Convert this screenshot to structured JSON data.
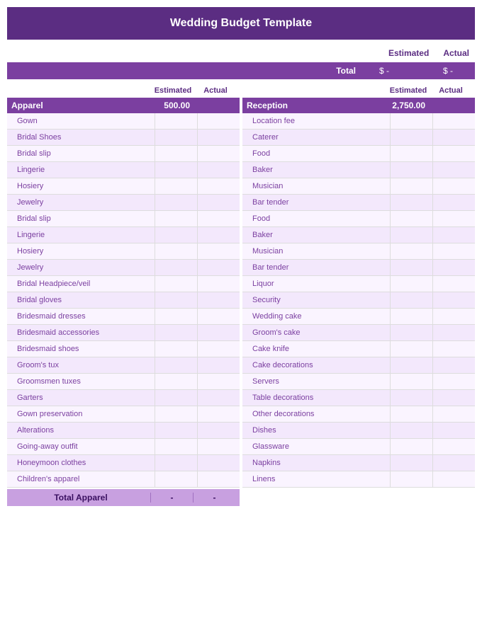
{
  "title": "Wedding Budget Template",
  "summary": {
    "estimated_label": "Estimated",
    "actual_label": "Actual",
    "total_label": "Total",
    "total_estimated": "$ -",
    "total_actual": "$ -"
  },
  "apparel": {
    "section_title": "Apparel",
    "section_amount": "500.00",
    "col_estimated": "Estimated",
    "col_actual": "Actual",
    "items": [
      "Gown",
      "Bridal Shoes",
      "Bridal slip",
      "Lingerie",
      "Hosiery",
      "Jewelry",
      "Bridal slip",
      "Lingerie",
      "Hosiery",
      "Jewelry",
      "Bridal Headpiece/veil",
      "Bridal gloves",
      "Bridesmaid dresses",
      "Bridesmaid accessories",
      "Bridesmaid shoes",
      "Groom's tux",
      "Groomsmen tuxes",
      "Garters",
      "Gown preservation",
      "Alterations",
      "Going-away outfit",
      "Honeymoon clothes",
      "Children's apparel"
    ],
    "total_label": "Total Apparel",
    "total_estimated": "-",
    "total_actual": "-"
  },
  "reception": {
    "section_title": "Reception",
    "section_amount": "2,750.00",
    "col_estimated": "Estimated",
    "col_actual": "Actual",
    "items": [
      "Location fee",
      "Caterer",
      "Food",
      "Baker",
      "Musician",
      "Bar tender",
      "Food",
      "Baker",
      "Musician",
      "Bar tender",
      "Liquor",
      "Security",
      "Wedding cake",
      "Groom's cake",
      "Cake knife",
      "Cake decorations",
      "Servers",
      "Table decorations",
      "Other decorations",
      "Dishes",
      "Glassware",
      "Napkins",
      "Linens"
    ]
  }
}
